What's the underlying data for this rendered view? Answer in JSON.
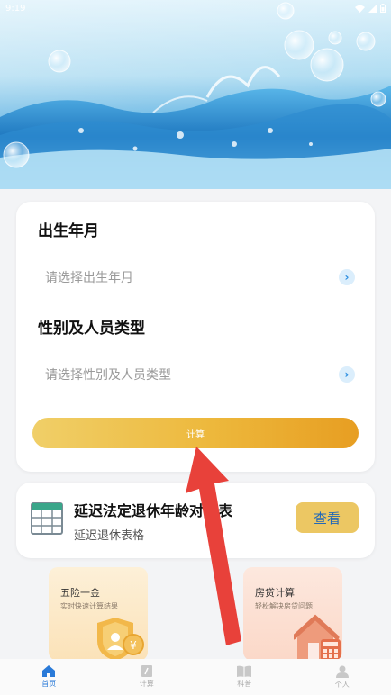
{
  "status_bar": {
    "time": "9:19"
  },
  "birth_section": {
    "title": "出生年月",
    "placeholder": "请选择出生年月"
  },
  "type_section": {
    "title": "性别及人员类型",
    "placeholder": "请选择性别及人员类型"
  },
  "calculate_button": "计算",
  "table_card": {
    "title": "延迟法定退休年龄对照表",
    "subtitle": "延迟退休表格",
    "view_button": "查看"
  },
  "tiles": [
    {
      "title": "五险一金",
      "subtitle": "实时快速计算结果"
    },
    {
      "title": "房贷计算",
      "subtitle": "轻松解决房贷问题"
    }
  ],
  "nav": [
    {
      "label": "首页",
      "icon": "home-icon",
      "active": true
    },
    {
      "label": "计算",
      "icon": "calculator-icon",
      "active": false
    },
    {
      "label": "科普",
      "icon": "book-icon",
      "active": false
    },
    {
      "label": "个人",
      "icon": "person-icon",
      "active": false
    }
  ],
  "colors": {
    "accent_blue": "#2a7ad8",
    "button_gold": "#edb83c",
    "view_button_bg": "#ecc763"
  }
}
